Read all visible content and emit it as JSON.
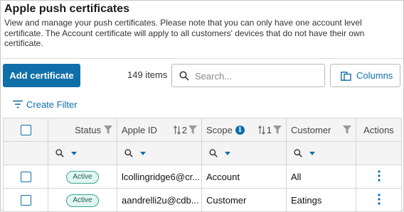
{
  "header": {
    "title": "Apple push certificates",
    "description": "View and manage your push certificates. Please note that you can only have one account level certificate. The Account certificate will apply to all customers' devices that do not have their own certificate."
  },
  "toolbar": {
    "add_label": "Add certificate",
    "item_count": "149 items",
    "search_placeholder": "Search...",
    "columns_label": "Columns",
    "create_filter_label": "Create Filter"
  },
  "table": {
    "columns": [
      {
        "key": "status",
        "label": "Status",
        "filter": true
      },
      {
        "key": "apple_id",
        "label": "Apple ID",
        "sort": "2",
        "filter": true
      },
      {
        "key": "scope",
        "label": "Scope",
        "info": true,
        "sort": "1",
        "filter": true
      },
      {
        "key": "customer",
        "label": "Customer",
        "filter": true
      },
      {
        "key": "actions",
        "label": "Actions"
      }
    ],
    "rows": [
      {
        "status": "Active",
        "apple_id": "lcollingridge6@cr...",
        "scope": "Account",
        "customer": "All"
      },
      {
        "status": "Active",
        "apple_id": "aandrelli2u@cdb...",
        "scope": "Customer",
        "customer": "Eatings"
      }
    ]
  },
  "colors": {
    "primary": "#0f6fa8",
    "badge_border": "#3aa58f",
    "badge_bg": "#e2f5ef"
  }
}
